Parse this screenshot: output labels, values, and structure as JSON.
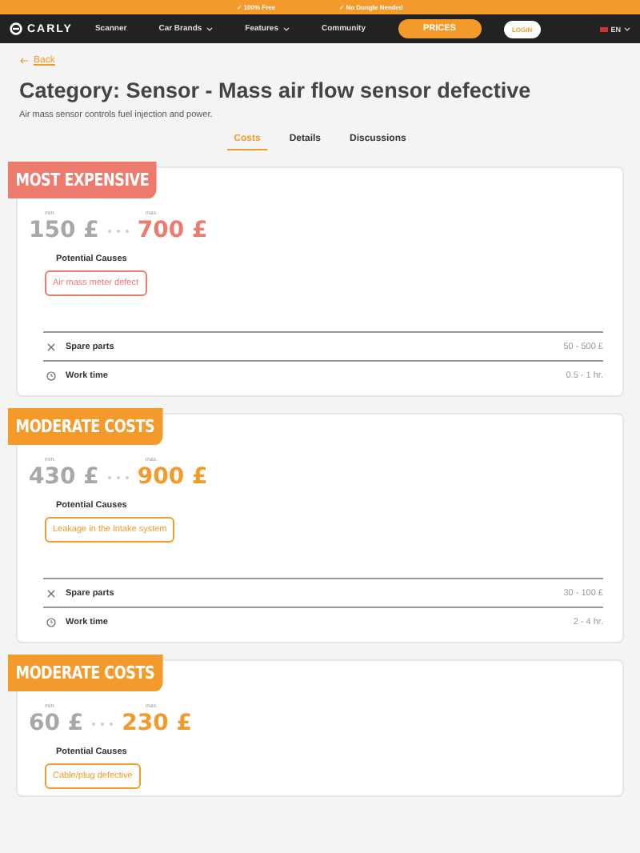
{
  "promo_bar": [
    "✓ 100% Free",
    "✓ No Dongle Needed"
  ],
  "nav": {
    "logo": "CARLY",
    "items": [
      {
        "label": "Scanner",
        "dropdown": false
      },
      {
        "label": "Car Brands",
        "dropdown": true
      },
      {
        "label": "Features",
        "dropdown": true
      },
      {
        "label": "Community",
        "dropdown": false
      }
    ],
    "prices": "PRICES",
    "login": "LOGIN",
    "language": "EN"
  },
  "back": "Back",
  "title": "Category: Sensor - Mass air flow sensor defective",
  "subtitle": "Air mass sensor controls fuel injection and power.",
  "tabs": [
    {
      "label": "Costs",
      "selected": true
    },
    {
      "label": "Details",
      "selected": false
    },
    {
      "label": "Discussions",
      "selected": false
    }
  ],
  "cards": [
    {
      "badge": "MOST EXPENSIVE",
      "color": "#ee7a6e",
      "min_label": "min.",
      "max_label": "max.",
      "min": "150 £",
      "max": "700 £",
      "causes_title": "Potential Causes",
      "causes": [
        "Air mass meter defect"
      ],
      "details": [
        {
          "kind": "parts",
          "label": "Spare parts",
          "value": "50 - 500 £"
        },
        {
          "kind": "time",
          "label": "Work time",
          "value": "0.5 - 1 hr."
        }
      ]
    },
    {
      "badge": "MODERATE COSTS",
      "color": "#f39a2b",
      "min_label": "min.",
      "max_label": "max.",
      "min": "430 £",
      "max": "900 £",
      "causes_title": "Potential Causes",
      "causes": [
        "Leakage in the intake system"
      ],
      "details": [
        {
          "kind": "parts",
          "label": "Spare parts",
          "value": "30 - 100 £"
        },
        {
          "kind": "time",
          "label": "Work time",
          "value": "2 - 4 hr."
        }
      ]
    },
    {
      "badge": "MODERATE COSTS",
      "color": "#f39a2b",
      "min_label": "min.",
      "max_label": "max.",
      "min": "60 £",
      "max": "230 £",
      "causes_title": "Potential Causes",
      "causes": [
        "Cable/plug defective"
      ]
    }
  ]
}
